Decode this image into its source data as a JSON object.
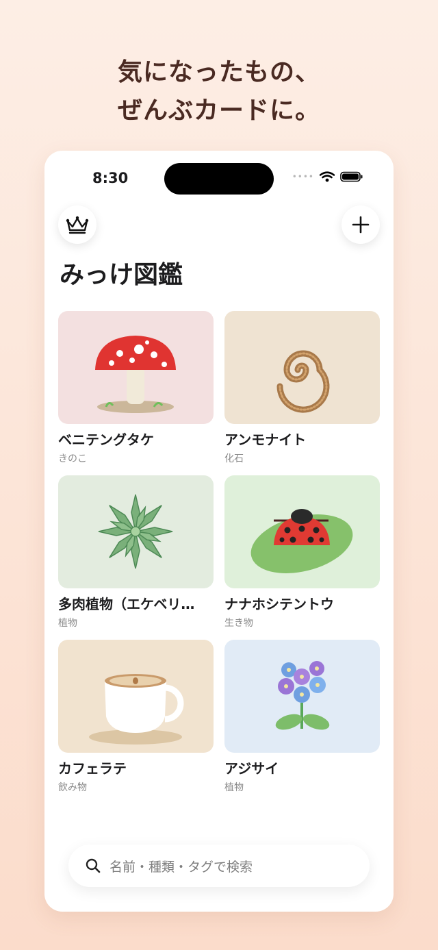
{
  "headline": {
    "line1": "気になったもの、",
    "line2": "ぜんぶカードに。"
  },
  "status_bar": {
    "time": "8:30"
  },
  "page": {
    "title": "みっけ図鑑"
  },
  "cards": [
    {
      "name": "ベニテングタケ",
      "category": "きのこ",
      "icon": "mushroom-illustration",
      "bg": "#f3e0e0"
    },
    {
      "name": "アンモナイト",
      "category": "化石",
      "icon": "ammonite-illustration",
      "bg": "#efe3d2"
    },
    {
      "name": "多肉植物（エケベリ…",
      "category": "植物",
      "icon": "succulent-illustration",
      "bg": "#e3ecdf"
    },
    {
      "name": "ナナホシテントウ",
      "category": "生き物",
      "icon": "ladybug-illustration",
      "bg": "#dff0da"
    },
    {
      "name": "カフェラテ",
      "category": "飲み物",
      "icon": "latte-illustration",
      "bg": "#f1e3cf"
    },
    {
      "name": "アジサイ",
      "category": "植物",
      "icon": "hydrangea-illustration",
      "bg": "#e1ebf6"
    }
  ],
  "search": {
    "placeholder": "名前・種類・タグで検索"
  }
}
